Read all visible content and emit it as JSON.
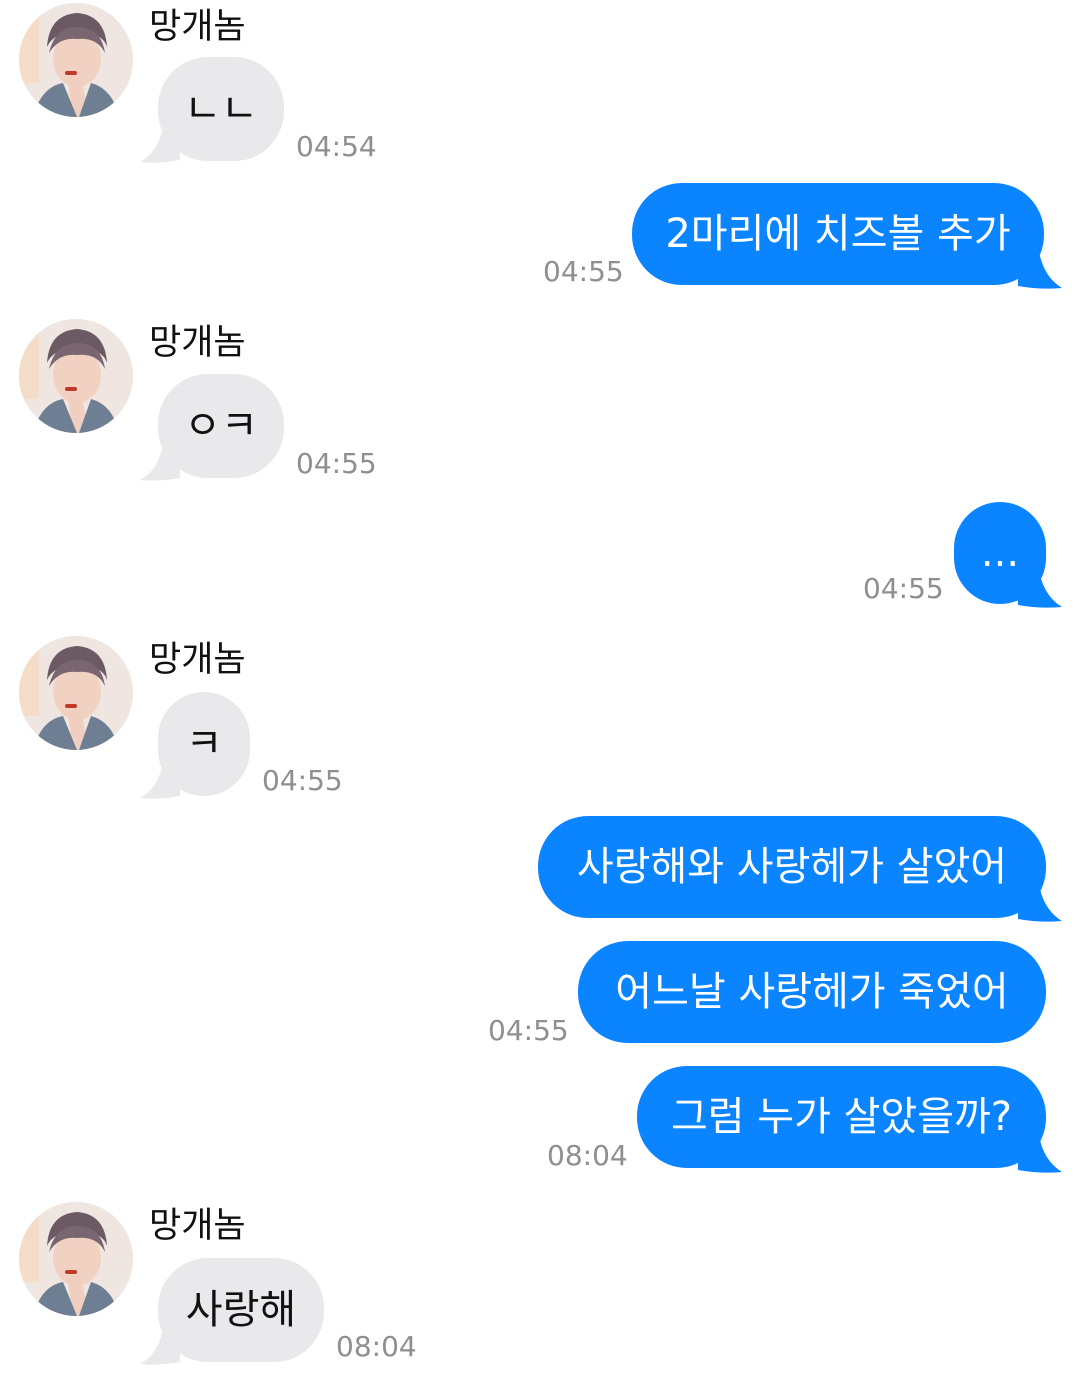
{
  "colors": {
    "incoming_bubble": "#e9e9eb",
    "outgoing_bubble": "#0a84ff",
    "timestamp": "#8e8e93"
  },
  "contact": {
    "name": "망개놈"
  },
  "messages": [
    {
      "direction": "incoming",
      "sender": "망개놈",
      "text": "ㄴㄴ",
      "time": "04:54"
    },
    {
      "direction": "outgoing",
      "text": "2마리에 치즈볼 추가",
      "time": "04:55"
    },
    {
      "direction": "incoming",
      "sender": "망개놈",
      "text": "ㅇㅋ",
      "time": "04:55"
    },
    {
      "direction": "outgoing",
      "text": "...",
      "time": "04:55"
    },
    {
      "direction": "incoming",
      "sender": "망개놈",
      "text": "ㅋ",
      "time": "04:55"
    },
    {
      "direction": "outgoing",
      "text": "사랑해와 사랑헤가 살았어"
    },
    {
      "direction": "outgoing",
      "text": "어느날 사랑헤가 죽었어",
      "time": "04:55"
    },
    {
      "direction": "outgoing",
      "text": "그럼 누가 살았을까?",
      "time": "08:04"
    },
    {
      "direction": "incoming",
      "sender": "망개놈",
      "text": "사랑해",
      "time": "08:04"
    }
  ]
}
